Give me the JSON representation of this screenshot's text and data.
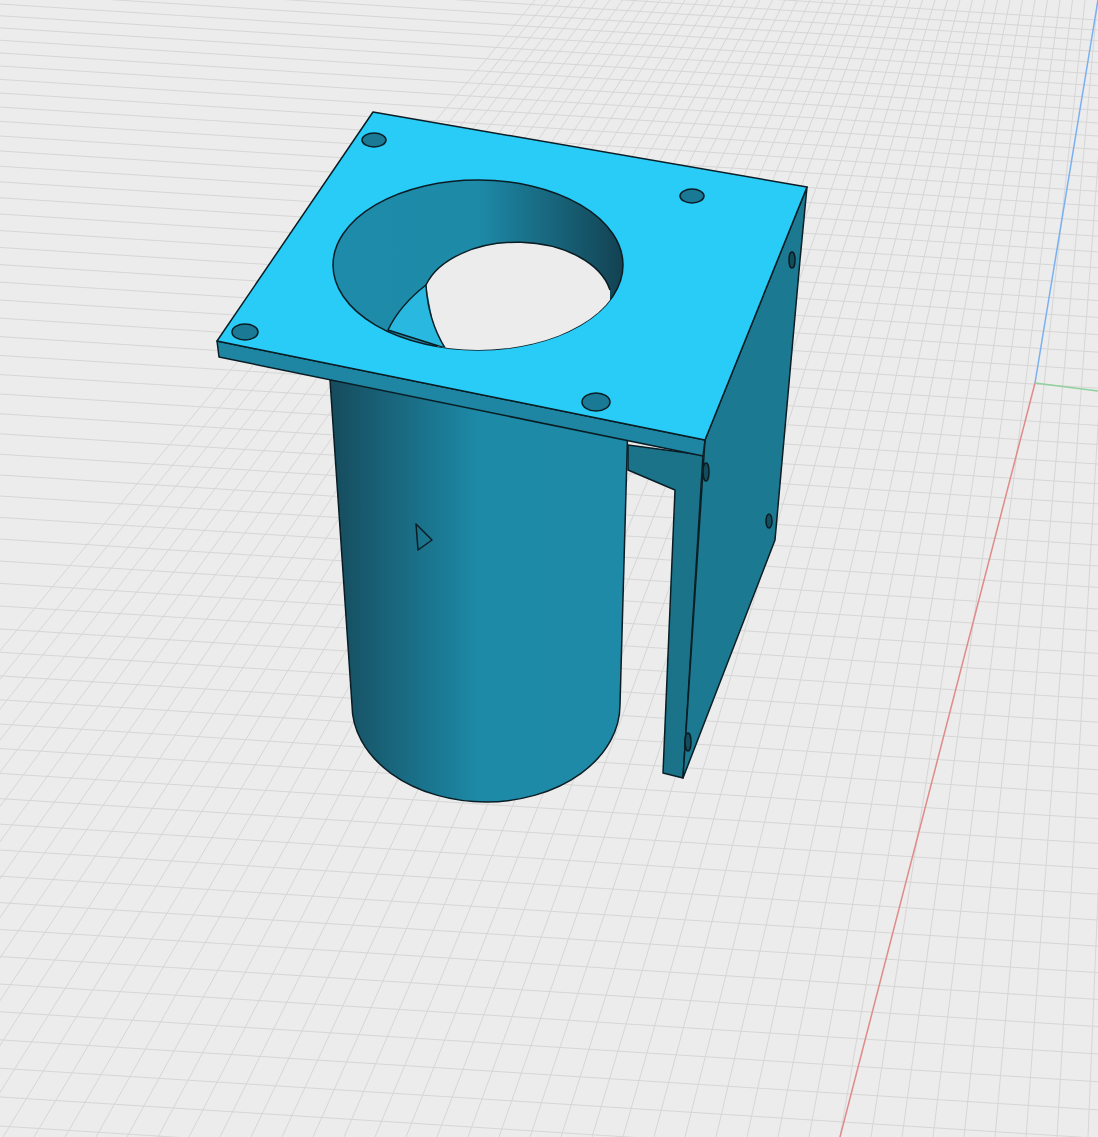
{
  "viewport": {
    "grid_visible": true,
    "axes_visible": true,
    "model_visible": true
  }
}
